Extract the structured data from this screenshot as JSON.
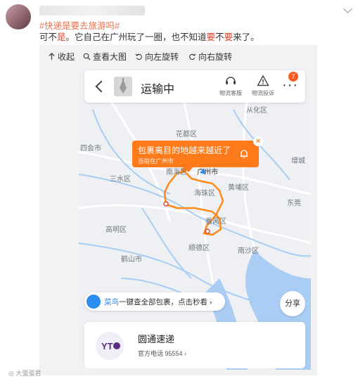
{
  "post": {
    "hashtag": "#快递是要去旅游吗#",
    "text_parts": [
      "可不",
      "是",
      "。它自己在广州玩了一圈，也不知道",
      "要",
      "不",
      "要",
      "来了。"
    ]
  },
  "toolbar": {
    "collapse": "收起",
    "view_large": "查看大图",
    "rotate_left": "向左旋转",
    "rotate_right": "向右旋转"
  },
  "app": {
    "status": "运输中",
    "tool1": "物流客服",
    "tool2": "物流投诉",
    "more": "···",
    "badge": "7"
  },
  "bubble": {
    "title": "包裹离目的地越来越近了",
    "subtitle": "当前在广州市",
    "close": "×"
  },
  "map_labels": {
    "conghua": "从化区",
    "huadu": "花都区",
    "sihui": "四会市",
    "zengcheng": "增城",
    "nanhai": "南海区",
    "guangzhou": "广州市",
    "sanshui": "三水区",
    "huangpu": "黄埔区",
    "haizhu": "海珠区",
    "dongguan": "东莞",
    "fanyu": "番禺区",
    "gaoming": "高明区",
    "heshan": "鹤山市",
    "shunde": "顺德区",
    "nansha": "南沙区"
  },
  "cainiao": {
    "brand": "菜鸟",
    "text": "一键查全部包裹，点击秒看",
    "arrow": "›"
  },
  "share": "分享",
  "courier": {
    "name": "圆通速递",
    "phone": "官方电话 95554 ›"
  },
  "watermark": "◎ 大蛋蛋君",
  "colors": {
    "route": "#ff8a1a",
    "accent": "#eb7350",
    "water": "#a9cdf3"
  }
}
